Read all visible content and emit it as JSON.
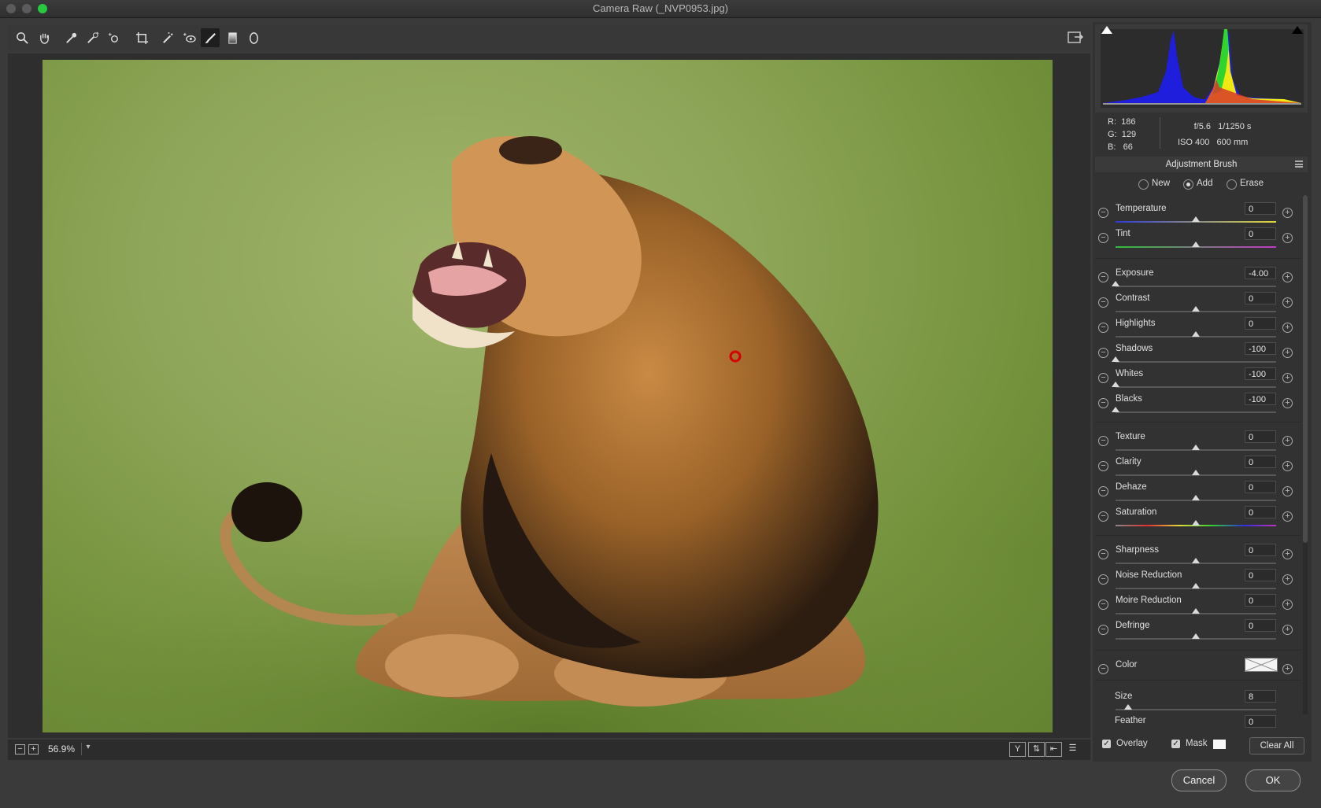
{
  "window": {
    "title": "Camera Raw (_NVP0953.jpg)"
  },
  "toolbar": {
    "tools": [
      {
        "name": "zoom-tool",
        "glyph": "🔍"
      },
      {
        "name": "hand-tool",
        "glyph": "✋"
      }
    ]
  },
  "preview": {
    "zoom": "56.9%"
  },
  "info": {
    "r_label": "R:",
    "r": "186",
    "g_label": "G:",
    "g": "129",
    "b_label": "B:",
    "b": "66",
    "aperture": "f/5.6",
    "shutter": "1/1250 s",
    "iso": "ISO 400",
    "focal": "600 mm"
  },
  "panel": {
    "title": "Adjustment Brush",
    "modes": {
      "new": "New",
      "add": "Add",
      "erase": "Erase"
    },
    "sliders": [
      {
        "label": "Temperature",
        "value": "0",
        "pos": 0.5
      },
      {
        "label": "Tint",
        "value": "0",
        "pos": 0.5
      },
      {
        "label": "Exposure",
        "value": "-4.00",
        "pos": 0.0
      },
      {
        "label": "Contrast",
        "value": "0",
        "pos": 0.5
      },
      {
        "label": "Highlights",
        "value": "0",
        "pos": 0.5
      },
      {
        "label": "Shadows",
        "value": "-100",
        "pos": 0.0
      },
      {
        "label": "Whites",
        "value": "-100",
        "pos": 0.0
      },
      {
        "label": "Blacks",
        "value": "-100",
        "pos": 0.0
      },
      {
        "label": "Texture",
        "value": "0",
        "pos": 0.5
      },
      {
        "label": "Clarity",
        "value": "0",
        "pos": 0.5
      },
      {
        "label": "Dehaze",
        "value": "0",
        "pos": 0.5
      },
      {
        "label": "Saturation",
        "value": "0",
        "pos": 0.5
      },
      {
        "label": "Sharpness",
        "value": "0",
        "pos": 0.5
      },
      {
        "label": "Noise Reduction",
        "value": "0",
        "pos": 0.5
      },
      {
        "label": "Moire Reduction",
        "value": "0",
        "pos": 0.5
      },
      {
        "label": "Defringe",
        "value": "0",
        "pos": 0.5
      }
    ],
    "color_label": "Color",
    "size_label": "Size",
    "size_value": "8",
    "feather_label": "Feather",
    "feather_value": "0",
    "overlay_label": "Overlay",
    "mask_label": "Mask",
    "clear_all": "Clear All"
  },
  "footer": {
    "cancel": "Cancel",
    "ok": "OK"
  }
}
